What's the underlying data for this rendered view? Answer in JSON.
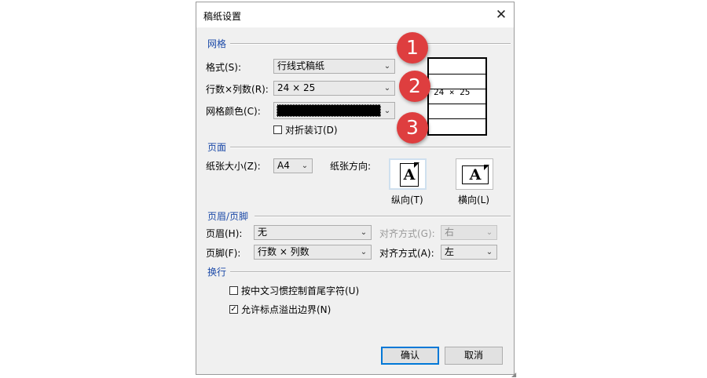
{
  "dialog": {
    "title": "稿纸设置",
    "close_glyph": "✕"
  },
  "grid_section": {
    "title": "网格",
    "format_label": "格式(S):",
    "format_value": "行线式稿纸",
    "rows_cols_label": "行数×列数(R):",
    "rows_cols_value": "24 × 25",
    "color_label": "网格颜色(C):",
    "color_value": "#000000",
    "fold_binding_label": "对折装订(D)",
    "fold_binding_checked": false,
    "preview_text": "24 × 25"
  },
  "page_section": {
    "title": "页面",
    "paper_size_label": "纸张大小(Z):",
    "paper_size_value": "A4",
    "orientation_label": "纸张方向:",
    "portrait_label": "纵向(T)",
    "landscape_label": "横向(L)",
    "icon_letter": "A",
    "selected_orientation": "portrait"
  },
  "header_footer_section": {
    "title": "页眉/页脚",
    "header_label": "页眉(H):",
    "header_value": "无",
    "header_align_label": "对齐方式(G):",
    "header_align_value": "右",
    "header_align_enabled": false,
    "footer_label": "页脚(F):",
    "footer_value": "行数 × 列数",
    "footer_align_label": "对齐方式(A):",
    "footer_align_value": "左"
  },
  "wrap_section": {
    "title": "换行",
    "control_chars_label": "按中文习惯控制首尾字符(U)",
    "control_chars_checked": false,
    "allow_overflow_label": "允许标点溢出边界(N)",
    "allow_overflow_checked": true
  },
  "buttons": {
    "ok": "确认",
    "cancel": "取消"
  },
  "callouts": [
    "1",
    "2",
    "3"
  ],
  "colors": {
    "section_title": "#1c4aa8",
    "callout": "#de3e3f",
    "default_button_border": "#0078d7"
  }
}
